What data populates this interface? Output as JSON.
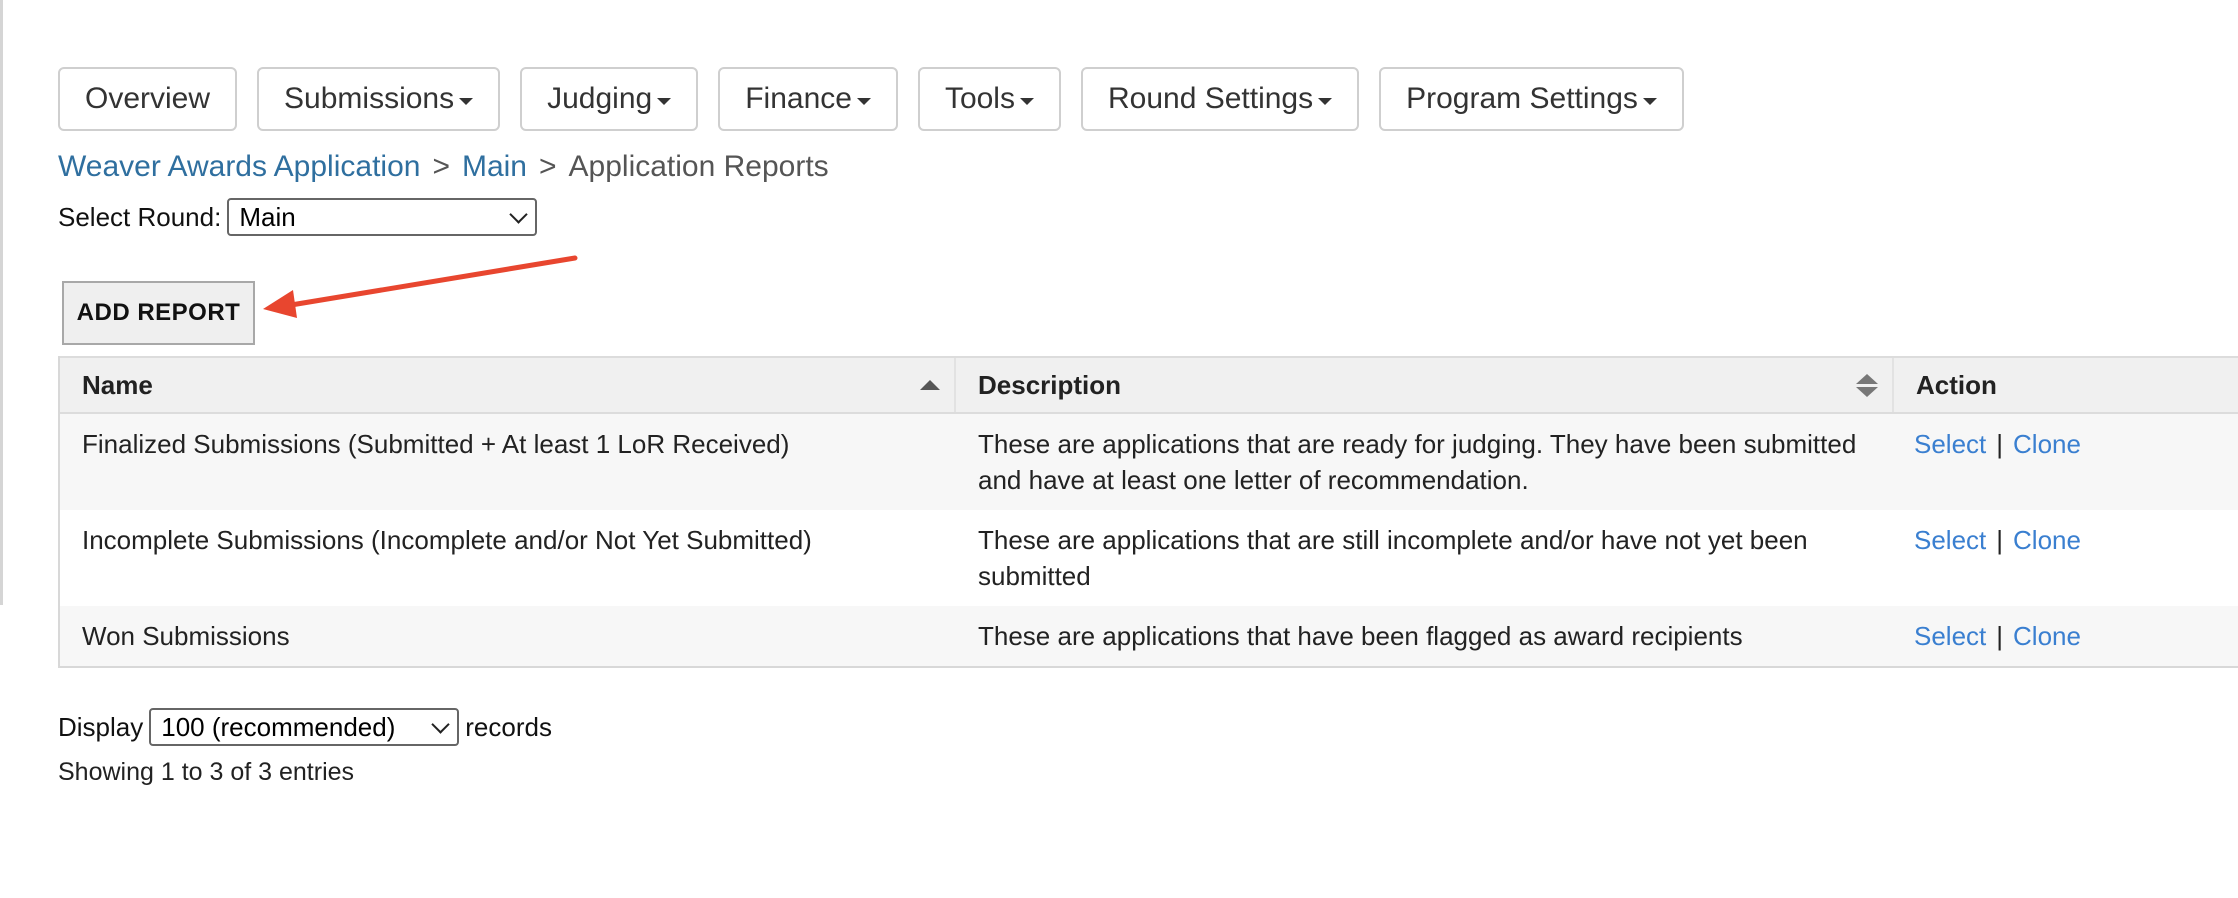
{
  "nav": {
    "overview": "Overview",
    "submissions": "Submissions",
    "judging": "Judging",
    "finance": "Finance",
    "tools": "Tools",
    "round_settings": "Round Settings",
    "program_settings": "Program Settings"
  },
  "breadcrumb": {
    "program": "Weaver Awards Application",
    "sep1": ">",
    "round": "Main",
    "sep2": ">",
    "current": "Application Reports"
  },
  "round_select": {
    "label": "Select Round:",
    "value": "Main"
  },
  "add_report_label": "ADD REPORT",
  "table": {
    "headers": {
      "name": "Name",
      "description": "Description",
      "action": "Action"
    },
    "rows": [
      {
        "name": "Finalized Submissions (Submitted + At least 1 LoR Received)",
        "description": "These are applications that are ready for judging. They have been submitted and have at least one letter of recommendation.",
        "select": "Select",
        "sep": "|",
        "clone": "Clone"
      },
      {
        "name": "Incomplete Submissions (Incomplete and/or Not Yet Submitted)",
        "description": "These are applications that are still incomplete and/or have not yet been submitted",
        "select": "Select",
        "sep": "|",
        "clone": "Clone"
      },
      {
        "name": "Won Submissions",
        "description": "These are applications that have been flagged as award recipients",
        "select": "Select",
        "sep": "|",
        "clone": "Clone"
      }
    ]
  },
  "display": {
    "label_before": "Display",
    "value": "100 (recommended)",
    "label_after": "records"
  },
  "showing": "Showing 1 to 3 of 3 entries",
  "colors": {
    "link": "#2f6f9f",
    "action_link": "#3a7fd0",
    "annotation_arrow": "#e8462f"
  },
  "icons": {
    "dropdown": "caret-down-icon",
    "sort_asc": "sort-asc-icon",
    "sort_both": "sort-both-icon",
    "select_chevron": "chevron-down-icon",
    "annotation": "red-arrow-annotation"
  }
}
